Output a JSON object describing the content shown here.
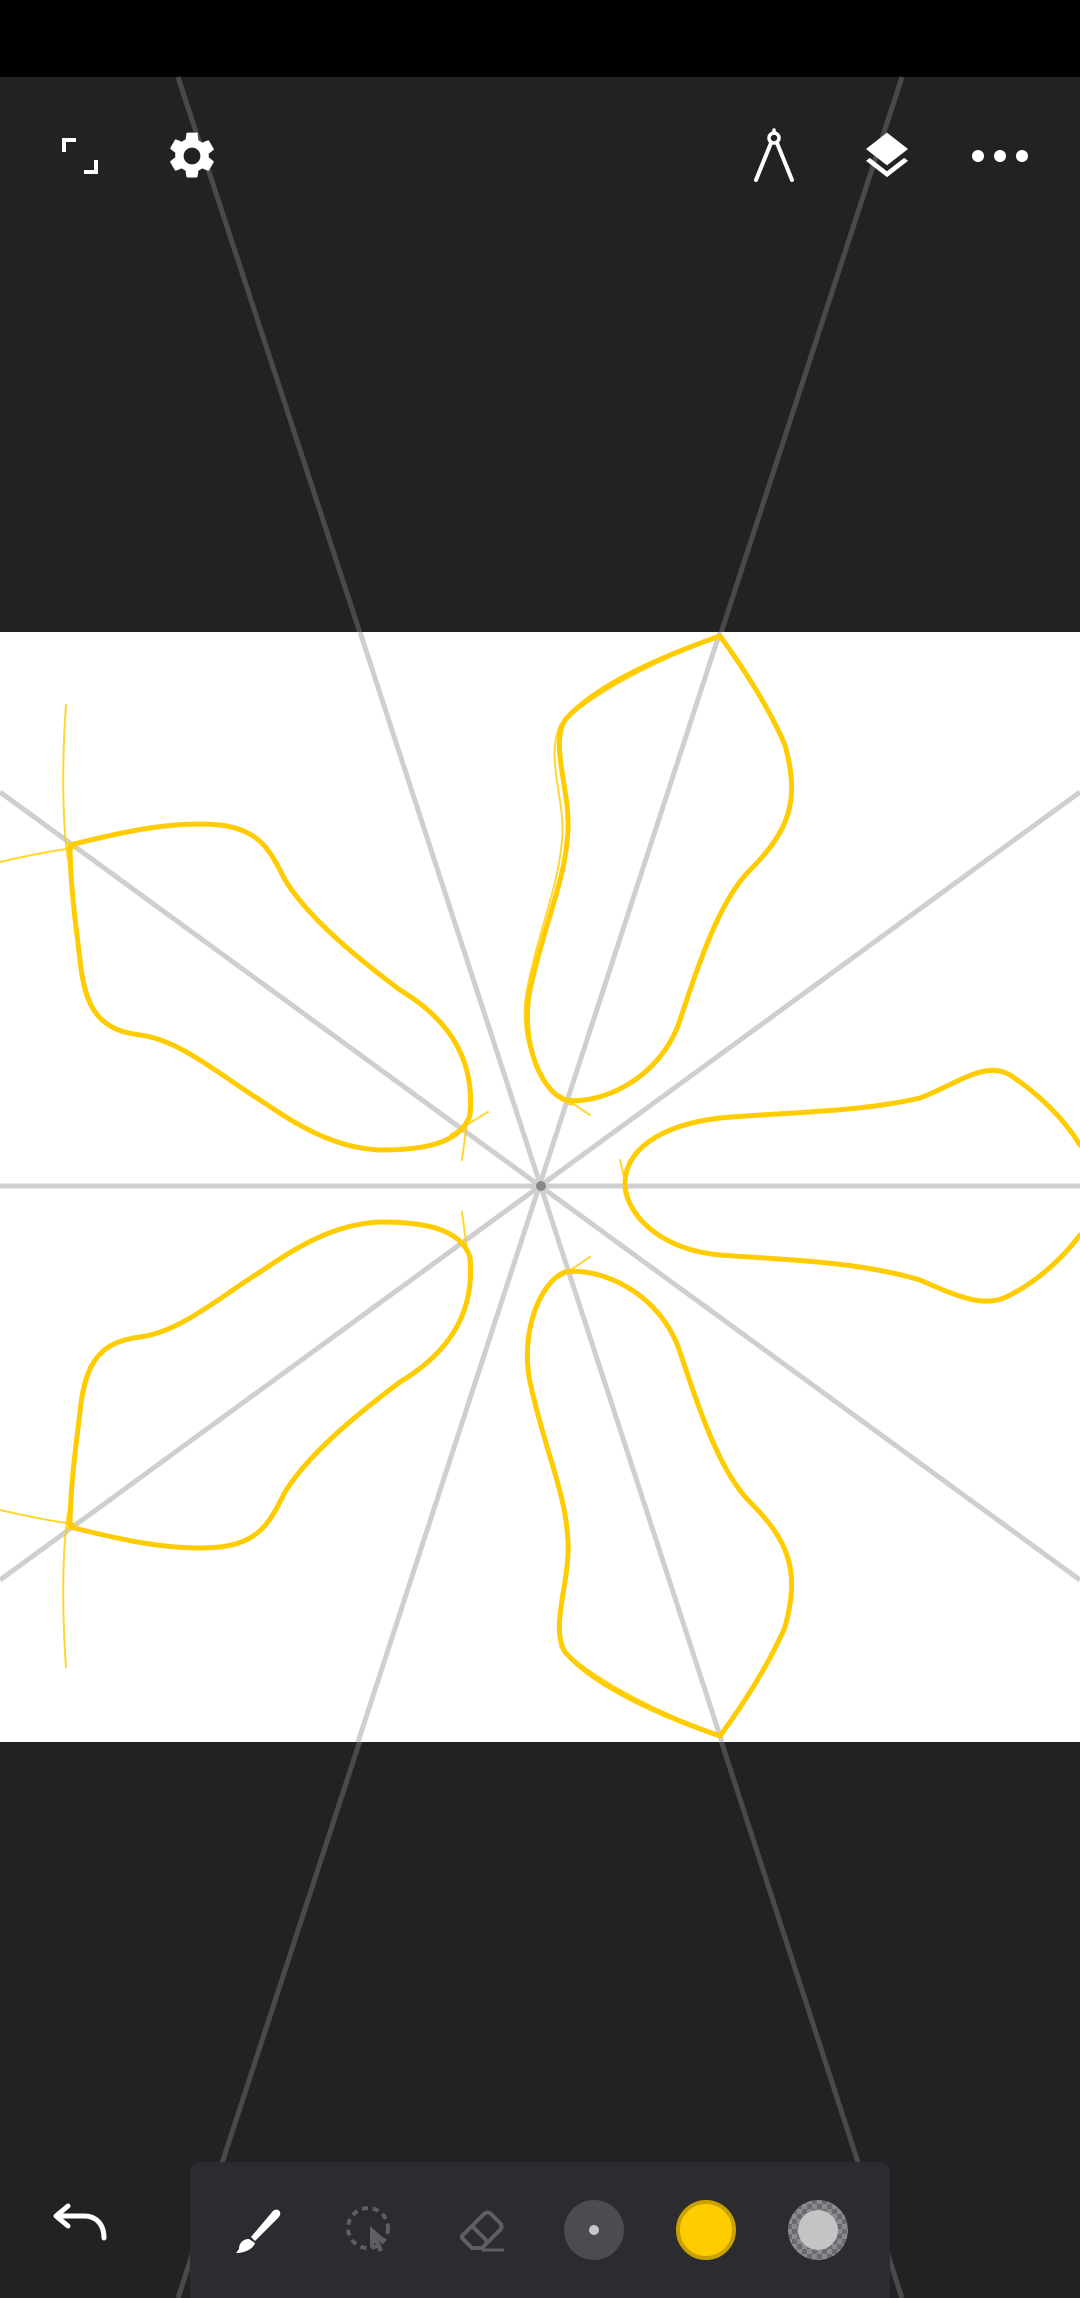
{
  "app": {
    "screen": "symmetry-drawing-canvas"
  },
  "top_bar": {
    "left": [
      {
        "id": "fullscreen",
        "icon": "fullscreen-icon"
      },
      {
        "id": "settings",
        "icon": "gear-icon"
      }
    ],
    "right": [
      {
        "id": "guides",
        "icon": "compass-icon"
      },
      {
        "id": "layers",
        "icon": "layers-icon"
      },
      {
        "id": "more",
        "icon": "more-horizontal-icon"
      }
    ]
  },
  "canvas": {
    "background": "#ffffff",
    "workspace_color": "#212224",
    "guide_color_on_canvas": "#cfcfcf",
    "guide_color_off_canvas": "#4a4a4c",
    "stroke_color": "#ffcc00",
    "symmetry_axes": 8
  },
  "toolbar": {
    "undo_icon": "undo-icon",
    "tools": [
      {
        "id": "brush",
        "icon": "brush-icon",
        "active": true
      },
      {
        "id": "lasso",
        "icon": "lasso-select-icon",
        "active": false
      },
      {
        "id": "eraser",
        "icon": "eraser-icon",
        "active": false
      },
      {
        "id": "brush-size",
        "icon": "brush-size-icon",
        "active": false
      },
      {
        "id": "color",
        "icon": "color-swatch-icon",
        "value": "#ffcc00"
      },
      {
        "id": "opacity",
        "icon": "opacity-icon",
        "active": false
      }
    ]
  }
}
